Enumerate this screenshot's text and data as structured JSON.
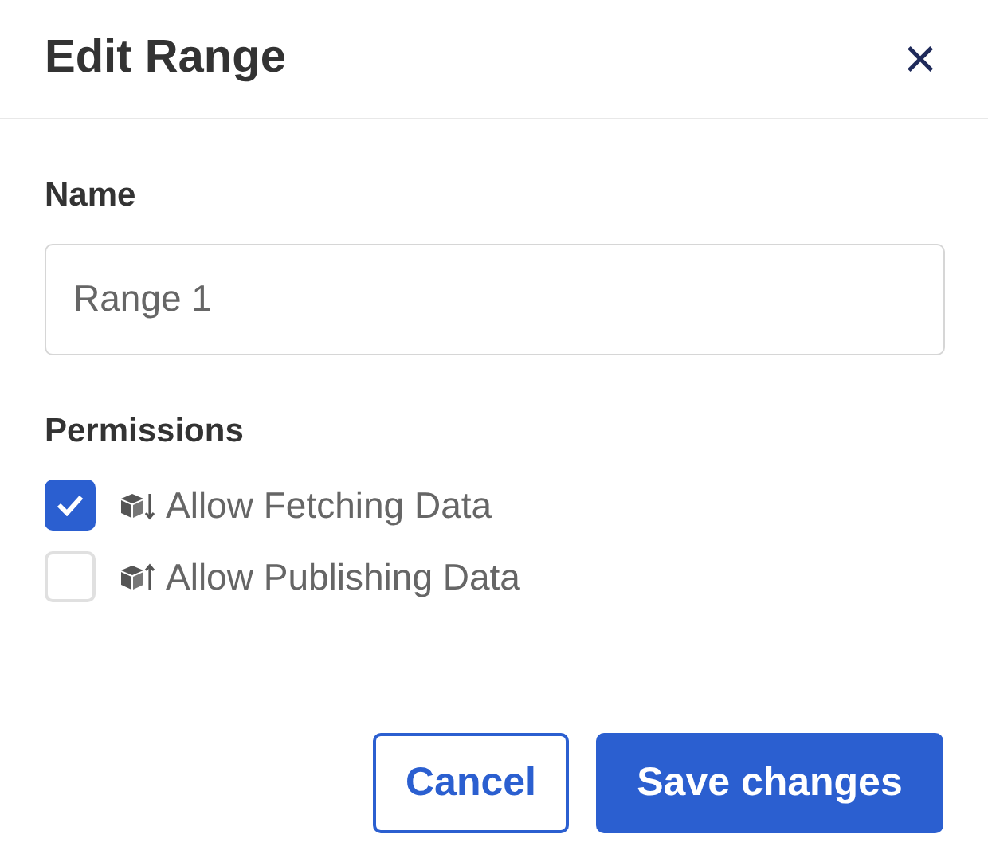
{
  "dialog": {
    "title": "Edit Range",
    "close": "×"
  },
  "name_field": {
    "label": "Name",
    "value": "Range 1"
  },
  "permissions": {
    "label": "Permissions",
    "items": [
      {
        "kind": "download",
        "label": "Allow Fetching Data",
        "checked": true
      },
      {
        "kind": "upload",
        "label": "Allow Publishing Data",
        "checked": false
      }
    ]
  },
  "buttons": {
    "cancel": "Cancel",
    "save": "Save changes"
  }
}
